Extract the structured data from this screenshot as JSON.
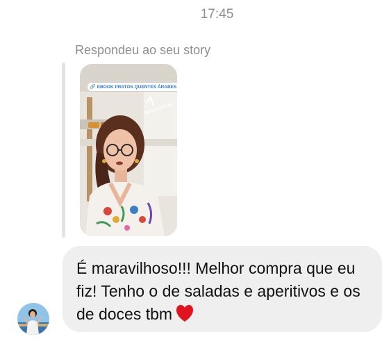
{
  "conversation": {
    "timestamp": "17:45"
  },
  "story_reply": {
    "label": "Respondeu ao seu story",
    "sticker_text": "EBOOK PRATOS QUENTES ÁRABES",
    "sticker_icon": "link-icon",
    "flag_icon": "lebanon-flag-icon",
    "scribble": "DONLE@ 0.6M"
  },
  "message": {
    "text": "É maravilhoso!!! Melhor compra que eu fiz! Tenho o de saladas e aperitivos e os de doces tbm",
    "emoji": "red-heart-icon"
  },
  "colors": {
    "bubble_bg": "#efefef",
    "meta_text": "#8e8e8e",
    "quote_bar": "#e3e3e3",
    "heart": "#e0141e",
    "link": "#2f77d6"
  }
}
